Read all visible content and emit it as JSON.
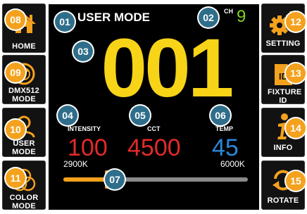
{
  "header": {
    "title": "USER MODE",
    "channel_label": "CH",
    "channel_value": "9"
  },
  "main_display": {
    "value": "001"
  },
  "params": [
    {
      "label": "INTENSITY",
      "value": "100",
      "color": "#e32a2a"
    },
    {
      "label": "CCT",
      "value": "4500",
      "color": "#e32a2a"
    },
    {
      "label": "TEMP",
      "value": "45",
      "color": "#2a87d8"
    }
  ],
  "slider": {
    "min_label": "2900K",
    "max_label": "6000K",
    "position_fraction": 0.24
  },
  "left_buttons": [
    {
      "label": "HOME",
      "icon": "home-icon"
    },
    {
      "label": "DMX512 MODE",
      "icon": "dmx-icon"
    },
    {
      "label": "USER MODE",
      "icon": "user-icon"
    },
    {
      "label": "COLOR MODE",
      "icon": "color-circles-icon"
    }
  ],
  "right_buttons": [
    {
      "label": "SETTING",
      "icon": "gear-icon"
    },
    {
      "label": "FIXTURE ID",
      "icon": "id-icon"
    },
    {
      "label": "INFO",
      "icon": "info-icon"
    },
    {
      "label": "ROTATE",
      "icon": "rotate-icon"
    }
  ],
  "badges": {
    "b01": "01",
    "b02": "02",
    "b03": "03",
    "b04": "04",
    "b05": "05",
    "b06": "06",
    "b07": "07",
    "b08": "08",
    "b09": "09",
    "b10": "10",
    "b11": "11",
    "b12": "12",
    "b13": "13",
    "b14": "14",
    "b15": "15"
  },
  "colors": {
    "accent": "#f4a11d",
    "badge_blue": "#2f6e8a",
    "main_number": "#f7d417",
    "channel": "#7ed321"
  }
}
